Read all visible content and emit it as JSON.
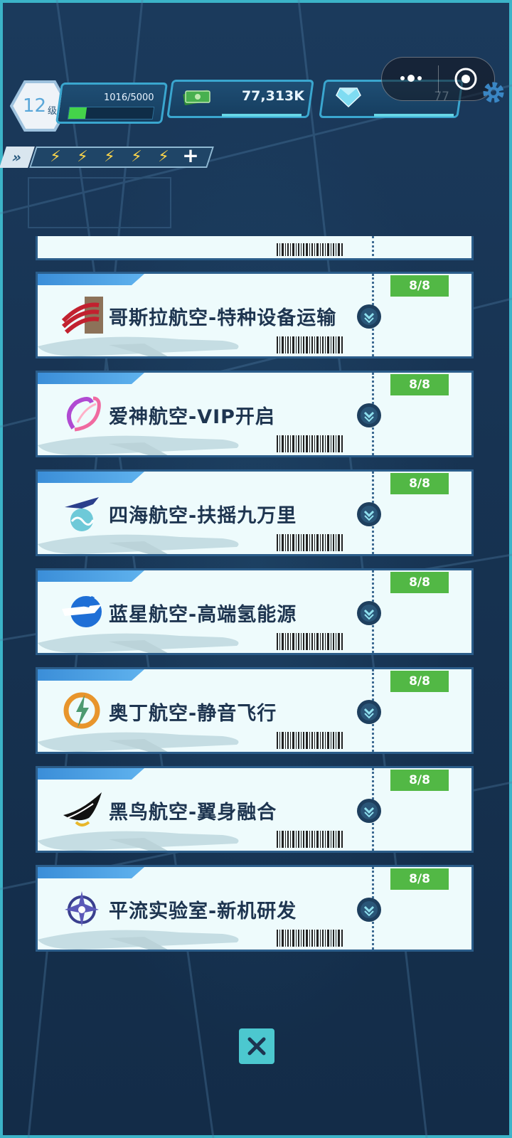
{
  "hud": {
    "level_number": "12",
    "level_unit": "级",
    "xp_text": "1016/5000",
    "xp_progress": 0.2,
    "money_text": "77,313K",
    "gem_text": "77",
    "energy_bolts": 5
  },
  "colors": {
    "accent": "#3aa6cf",
    "badge_green": "#52b845",
    "title_text": "#1e3550",
    "card_bg": "#eefbfc"
  },
  "airlines": [
    {
      "title": "哥斯拉航空-特种设备运输",
      "progress": "8/8",
      "logo": "stripes-logo"
    },
    {
      "title": "爱神航空-VIP开启",
      "progress": "8/8",
      "logo": "swirl-logo"
    },
    {
      "title": "四海航空-扶摇九万里",
      "progress": "8/8",
      "logo": "wave-plane-logo"
    },
    {
      "title": "蓝星航空-高端氢能源",
      "progress": "8/8",
      "logo": "blue-plane-logo"
    },
    {
      "title": "奥丁航空-静音飞行",
      "progress": "8/8",
      "logo": "lightning-ring-logo"
    },
    {
      "title": "黑鸟航空-翼身融合",
      "progress": "8/8",
      "logo": "black-wing-logo"
    },
    {
      "title": "平流实验室-新机研发",
      "progress": "8/8",
      "logo": "lab-plane-logo"
    }
  ]
}
